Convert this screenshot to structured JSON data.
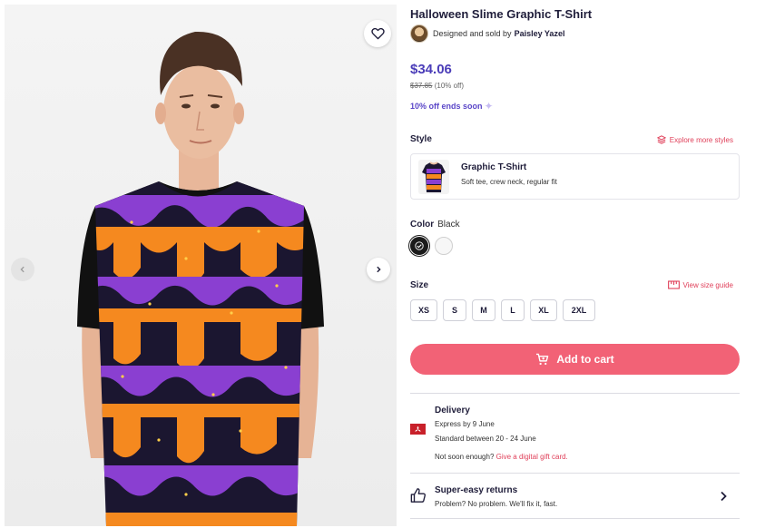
{
  "product": {
    "title": "Halloween Slime Graphic T-Shirt",
    "byline_prefix": "Designed and sold by",
    "designer": "Paisley Yazel",
    "price": "$34.06",
    "original_price": "$37.85",
    "discount_note": "(10% off)",
    "promo": "10% off ends soon"
  },
  "style": {
    "label": "Style",
    "explore_link": "Explore more styles",
    "name": "Graphic T-Shirt",
    "description": "Soft tee, crew neck, regular fit"
  },
  "color": {
    "label": "Color",
    "selected": "Black",
    "swatches": [
      {
        "name": "Black",
        "hex": "#1a1a1a",
        "selected": true
      },
      {
        "name": "White",
        "hex": "#f7f7f7",
        "selected": false
      }
    ]
  },
  "size": {
    "label": "Size",
    "guide_link": "View size guide",
    "options": [
      "XS",
      "S",
      "M",
      "L",
      "XL",
      "2XL"
    ]
  },
  "cart": {
    "label": "Add to cart"
  },
  "delivery": {
    "title": "Delivery",
    "express": "Express by 9 June",
    "standard": "Standard between 20 - 24 June",
    "gift_prefix": "Not soon enough?",
    "gift_link": "Give a digital gift card."
  },
  "returns": {
    "title": "Super-easy returns",
    "text": "Problem? No problem. We'll fix it, fast."
  },
  "icons": [
    "heart-icon",
    "chevron-left-icon",
    "chevron-right-icon",
    "layers-icon",
    "check-icon",
    "ruler-icon",
    "cart-icon",
    "flag-icon",
    "thumbs-up-icon"
  ],
  "colors": {
    "brand_purple": "#4a3cb8",
    "accent_pink": "#f26276",
    "link_red": "#e0405a",
    "shirt_orange": "#f5891f",
    "shirt_purple": "#8a3fd1"
  }
}
